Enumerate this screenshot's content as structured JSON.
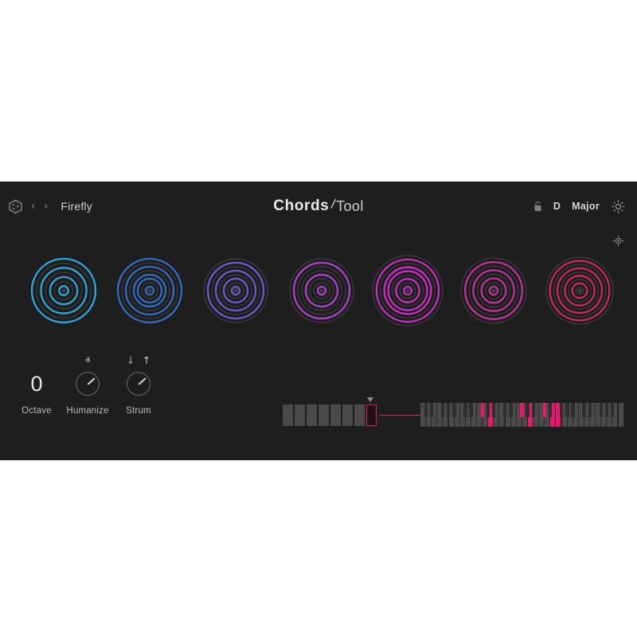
{
  "app": {
    "background_color": "#ffffff",
    "panel_color": "#1e1e1e",
    "accent_color": "#e8176b"
  },
  "header": {
    "cube_icon": "cube-icon",
    "prev_label": "‹",
    "next_label": "›",
    "preset_name": "Firefly",
    "brand_bold": "Chords",
    "brand_separator": "/",
    "brand_light": "Tool",
    "lock_icon": "lock-icon",
    "key_root": "D",
    "key_scale": "Major",
    "gear_icon": "gear-icon",
    "move_icon": "move-crosshair-icon"
  },
  "chords": {
    "count": 7,
    "slots": [
      {
        "index": 1,
        "color": "#2aa8e0",
        "ring_color": "#3a3a3a",
        "radius": 40,
        "ring_count": 7,
        "active_rings": [
          1,
          3,
          5,
          7
        ],
        "label": "chord-1"
      },
      {
        "index": 2,
        "color": "#2f6fc4",
        "ring_color": "#3a3a3a",
        "radius": 40,
        "ring_count": 8,
        "active_rings": [
          1,
          3,
          4,
          6,
          8
        ],
        "label": "chord-2"
      },
      {
        "index": 3,
        "color": "#7258d6",
        "ring_color": "#3a3a3a",
        "radius": 40,
        "ring_count": 8,
        "active_rings": [
          1,
          3,
          5,
          7
        ],
        "label": "chord-3"
      },
      {
        "index": 4,
        "color": "#b33fd1",
        "ring_color": "#3a3a3a",
        "radius": 40,
        "ring_count": 8,
        "active_rings": [
          1,
          4,
          7
        ],
        "label": "chord-4"
      },
      {
        "index": 5,
        "color": "#cf2bc9",
        "ring_color": "#3a3a3a",
        "radius": 44,
        "ring_count": 9,
        "active_rings": [
          1,
          3,
          5,
          6,
          8
        ],
        "label": "chord-5"
      },
      {
        "index": 6,
        "color": "#c62f9e",
        "ring_color": "#3a3a3a",
        "radius": 41,
        "ring_count": 8,
        "active_rings": [
          1,
          3,
          5,
          7
        ],
        "label": "chord-6"
      },
      {
        "index": 7,
        "color": "#d6245e",
        "ring_color": "#3a3a3a",
        "radius": 42,
        "ring_count": 9,
        "active_rings": [
          2,
          4,
          6,
          8
        ],
        "label": "chord-7"
      }
    ]
  },
  "controls": [
    {
      "name": "octave",
      "label": "Octave",
      "value": "0",
      "type": "value",
      "arrows": []
    },
    {
      "name": "humanize",
      "label": "Humanize",
      "value": "",
      "type": "knob",
      "knob_angle": -42,
      "arrows": [
        "ⱏ"
      ]
    },
    {
      "name": "strum",
      "label": "Strum",
      "value": "",
      "type": "knob",
      "knob_angle": -42,
      "arrows": [
        "↓",
        "↑"
      ]
    }
  ],
  "sequencer": {
    "step_count": 8,
    "active_step_index": 8,
    "playhead_label": "play-position-marker",
    "connector_color": "#d6245e"
  },
  "keyboard": {
    "white_key_count": 36,
    "active_white_keys": [
      13,
      20,
      24,
      25
    ],
    "active_black_keys": [
      8,
      13,
      16
    ],
    "white_key_color": "#4a4a4a",
    "black_key_color": "#2e2e2e",
    "active_key_color": "#e8176b"
  }
}
